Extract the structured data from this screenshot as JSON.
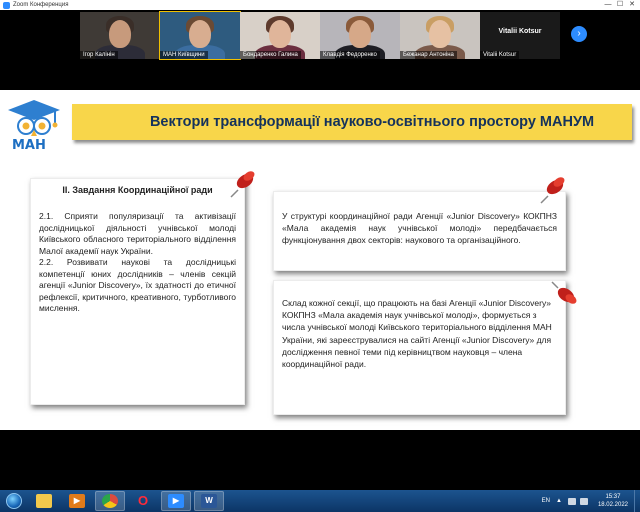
{
  "window": {
    "title": "Zoom Конференция",
    "controls": [
      "—",
      "☐",
      "✕"
    ]
  },
  "participants": [
    {
      "name": "Ігор Калінін",
      "face": "#c79a7c",
      "hair": "#3a2e28",
      "body": "#2c2c38",
      "bg": "#3f3a36"
    },
    {
      "name": "МАН Київщини",
      "face": "#d8ad90",
      "hair": "#6b4a33",
      "body": "#3b6da0",
      "bg": "#2e5b7f"
    },
    {
      "name": "Бондаренко Галина",
      "face": "#e0b59a",
      "hair": "#5e3a2c",
      "body": "#6b2e3f",
      "bg": "#d8d0c8"
    },
    {
      "name": "Клавдія Федоренко",
      "face": "#d6a888",
      "hair": "#8a5a3a",
      "body": "#1d1d24",
      "bg": "#b7b5ba"
    },
    {
      "name": "Бежанар Антоніна",
      "face": "#e6c1a3",
      "hair": "#c99e63",
      "body": "#7a5a4a",
      "bg": "#c9c4bf"
    },
    {
      "name": "Vitalii Kotsur",
      "center_name": "Vitalii Kotsur"
    }
  ],
  "next_page_icon": "chevron-right-icon",
  "slide": {
    "logo_text": "МАН",
    "title": "Вектори трансформації науково-освітнього простору МАНУМ",
    "box1": {
      "heading": "ІІ. Завдання Координаційної ради",
      "item1": "2.1. Сприяти популяризації та активізації дослідницької діяльності учнівської молоді Київського обласного територіального відділення Малої академії наук України.",
      "item2": "2.2. Розвивати наукові та дослідницькі компетенції юних дослідників – членів секцій агенції «Junior Discovery», їх здатності до етичної рефлексії, критичного, креативного, турботливого мислення."
    },
    "box2": {
      "text": "У структурі координаційної ради Агенції «Junior Discovery» КОКПНЗ «Мала академія наук учнівської молоді» передбачається функціонування двох секторів: наукового та організаційного."
    },
    "box3": {
      "text": "Склад кожної секції, що працюють на базі Агенції «Junior Discovery» КОКПНЗ «Мала академія наук учнівської молоді», формується з числа учнівської молоді Київського територіального відділення МАН України, які зареєструвалися на сайті Агенції «Junior Discovery» для дослідження певної теми під керівництвом  науковця – члена координаційної ради."
    }
  },
  "presentation_tools": [
    "◀",
    "▶",
    "✎",
    "▭",
    "⚲",
    "⋯"
  ],
  "taskbar": {
    "apps": [
      {
        "name": "explorer",
        "label": "",
        "color": "#f2c94c",
        "active": false
      },
      {
        "name": "media",
        "label": "▶",
        "color": "#e07b1a",
        "active": false
      },
      {
        "name": "chrome",
        "label": "",
        "color": "#dd4b3e",
        "active": true
      },
      {
        "name": "opera",
        "label": "O",
        "color": "#cc1b2b",
        "active": false
      },
      {
        "name": "zoom",
        "label": "▶",
        "color": "#2d8cff",
        "active": true
      },
      {
        "name": "word",
        "label": "W",
        "color": "#2b5797",
        "active": true
      }
    ],
    "language": "EN",
    "time": "15:37",
    "date": "18.02.2022"
  }
}
